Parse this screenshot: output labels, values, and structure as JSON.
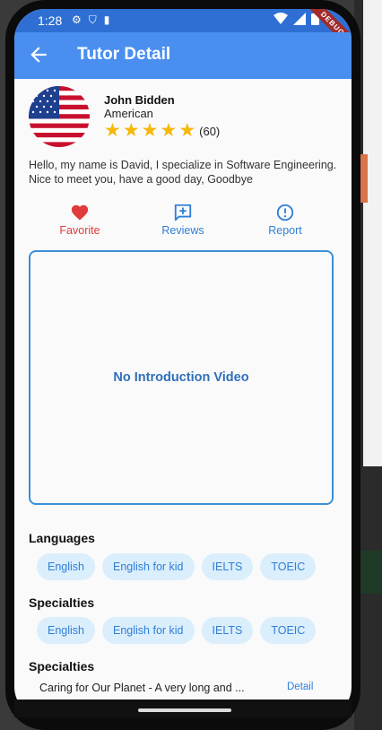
{
  "status": {
    "time": "1:28",
    "debug": "DEBUG"
  },
  "app": {
    "title": "Tutor Detail"
  },
  "tutor": {
    "name": "John Bidden",
    "nationality": "American",
    "rating_count": "(60)",
    "rating": 5,
    "bio": "Hello, my name is David, I specialize in Software Engineering. Nice to meet you, have a good day, Goodbye"
  },
  "actions": {
    "favorite": "Favorite",
    "reviews": "Reviews",
    "report": "Report"
  },
  "video": {
    "placeholder": "No Introduction Video"
  },
  "sections": {
    "languages": {
      "title": "Languages",
      "items": [
        "English",
        "English for kid",
        "IELTS",
        "TOEIC"
      ]
    },
    "specialties": {
      "title": "Specialties",
      "items": [
        "English",
        "English for kid",
        "IELTS",
        "TOEIC"
      ]
    },
    "courses": {
      "title": "Specialties",
      "items": [
        {
          "title": "Caring for Our Planet - A very long and ...",
          "action": "Detail"
        }
      ]
    }
  },
  "colors": {
    "primary": "#4a8ff0",
    "status_bar": "#2f6fd4",
    "favorite": "#e23b3b",
    "accent": "#2f7fd8",
    "chip_bg": "#dbeefc",
    "star": "#f5b80b"
  },
  "icons": {
    "back": "arrow-left-icon",
    "favorite": "heart-icon",
    "reviews": "comment-plus-icon",
    "report": "alert-circle-icon"
  }
}
